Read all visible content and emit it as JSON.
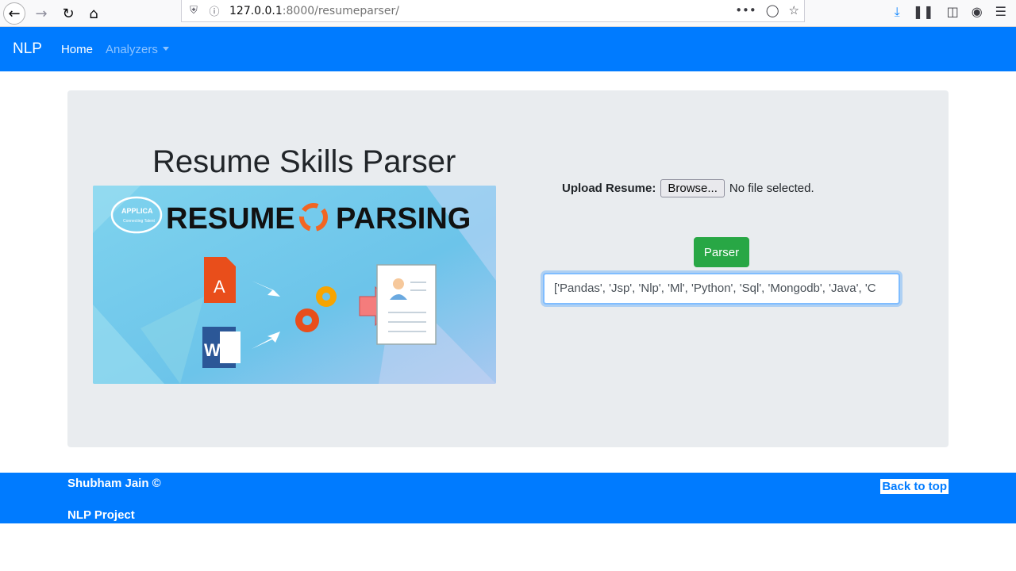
{
  "browser": {
    "url_host": "127.0.0.1",
    "url_path": ":8000/resumeparser/",
    "icons": [
      "back-icon",
      "forward-icon",
      "reload-icon",
      "home-icon",
      "shield-icon",
      "info-icon",
      "more-icon",
      "pocket-icon",
      "bookmark-star-icon",
      "download-icon",
      "library-icon",
      "sidebar-icon",
      "account-icon",
      "menu-icon"
    ]
  },
  "navbar": {
    "brand": "NLP",
    "home": "Home",
    "analyzers": "Analyzers"
  },
  "main": {
    "title": "Resume Skills Parser",
    "banner": {
      "logo_text": "APPLICA",
      "logo_sub": "Connecting Talent",
      "heading_left": "RESUME",
      "heading_right": "PARSING"
    },
    "upload_label": "Upload Resume:",
    "browse_label": "Browse...",
    "file_status": "No file selected.",
    "parser_button": "Parser",
    "result_value": "['Pandas', 'Jsp', 'Nlp', 'Ml', 'Python', 'Sql', 'Mongodb', 'Java', 'C"
  },
  "footer": {
    "author": "Shubham Jain ©",
    "project": "NLP Project",
    "back_to_top": "Back to top"
  },
  "colors": {
    "primary": "#007bff",
    "success": "#28a745",
    "jumbotron": "#e9ecef"
  }
}
